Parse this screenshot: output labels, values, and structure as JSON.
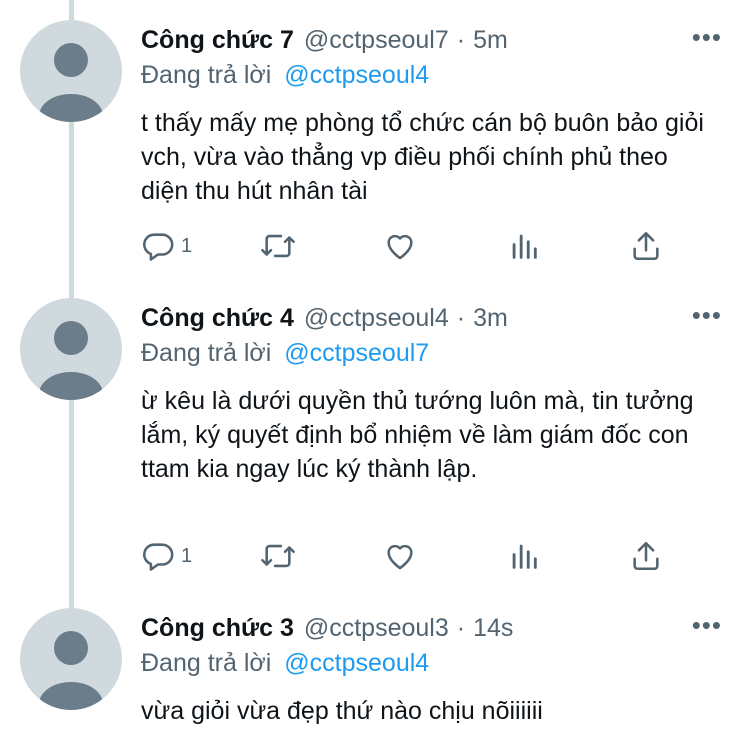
{
  "tweets": [
    {
      "name": "Công chức 7",
      "handle": "@cctpseoul7",
      "time": "5m",
      "reply_prefix": "Đang trả lời",
      "reply_mention": "@cctpseoul4",
      "text": "t thấy mấy mẹ phòng tổ chức cán bộ buôn bảo giỏi vch, vừa vào thẳng vp điều phối chính phủ theo diện thu hút nhân tài",
      "reply_count": "1"
    },
    {
      "name": "Công chức 4",
      "handle": "@cctpseoul4",
      "time": "3m",
      "reply_prefix": "Đang trả lời",
      "reply_mention": "@cctpseoul7",
      "text": "ừ kêu là dưới quyền thủ tướng luôn mà, tin tưởng lắm, ký quyết định bổ nhiệm về làm giám đốc con ttam kia ngay lúc ký thành lập.",
      "reply_count": "1"
    },
    {
      "name": "Công chức 3",
      "handle": "@cctpseoul3",
      "time": "14s",
      "reply_prefix": "Đang trả lời",
      "reply_mention": "@cctpseoul4",
      "text": "vừa giỏi vừa đẹp thứ nào chịu nõiiiiii",
      "reply_count": ""
    }
  ],
  "separator": "·",
  "more_label": "•••",
  "icons": {
    "reply": "reply-icon",
    "retweet": "retweet-icon",
    "like": "heart-icon",
    "analytics": "analytics-icon",
    "share": "share-icon",
    "more": "more-icon",
    "avatar": "default-avatar-icon"
  },
  "colors": {
    "text": "#0f1419",
    "secondary": "#536471",
    "link": "#1d9bf0",
    "thread_line": "#cfd9de",
    "avatar_bg": "#cfd9de",
    "avatar_fg": "#6b7c8a"
  }
}
